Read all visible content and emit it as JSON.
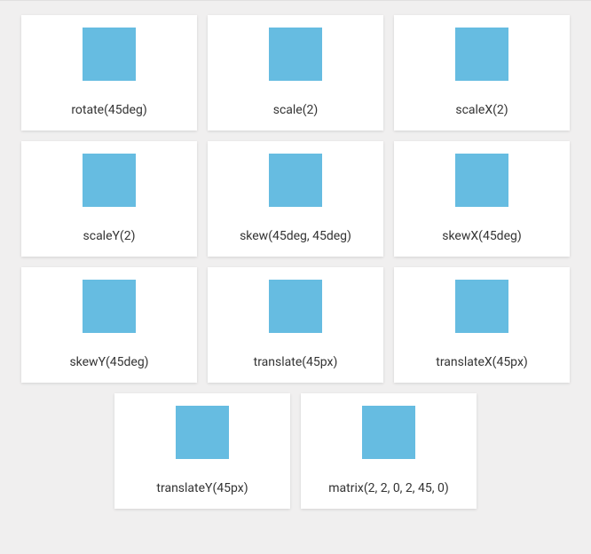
{
  "cards": [
    {
      "label": "rotate(45deg)"
    },
    {
      "label": "scale(2)"
    },
    {
      "label": "scaleX(2)"
    },
    {
      "label": "scaleY(2)"
    },
    {
      "label": "skew(45deg, 45deg)"
    },
    {
      "label": "skewX(45deg)"
    },
    {
      "label": "skewY(45deg)"
    },
    {
      "label": "translate(45px)"
    },
    {
      "label": "translateX(45px)"
    },
    {
      "label": "translateY(45px)"
    },
    {
      "label": "matrix(2, 2, 0, 2, 45, 0)"
    }
  ],
  "colors": {
    "square": "#66bce1",
    "cardBg": "#ffffff",
    "pageBg": "#f0efef"
  }
}
